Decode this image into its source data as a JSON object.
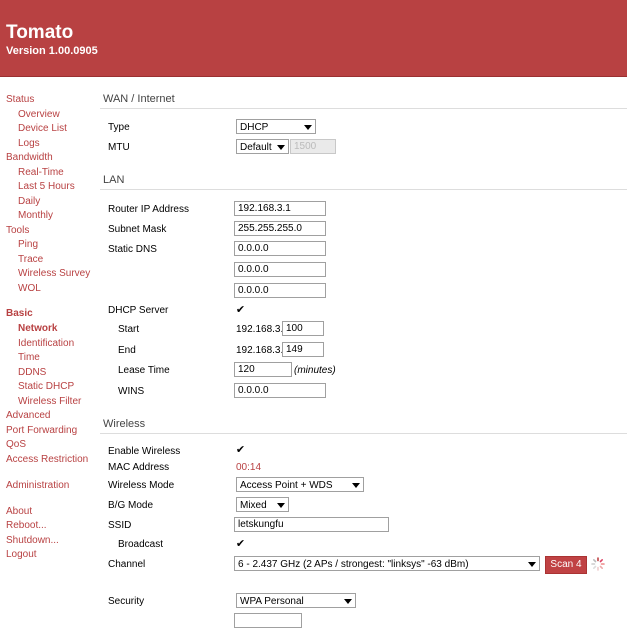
{
  "header": {
    "title": "Tomato",
    "version": "Version 1.00.0905"
  },
  "nav": {
    "status": "Status",
    "overview": "Overview",
    "device_list": "Device List",
    "logs": "Logs",
    "bandwidth": "Bandwidth",
    "real_time": "Real-Time",
    "last_5_hours": "Last 5 Hours",
    "daily": "Daily",
    "monthly": "Monthly",
    "tools": "Tools",
    "ping": "Ping",
    "trace": "Trace",
    "wireless_survey": "Wireless Survey",
    "wol": "WOL",
    "basic": "Basic",
    "network": "Network",
    "identification": "Identification",
    "time": "Time",
    "ddns": "DDNS",
    "static_dhcp": "Static DHCP",
    "wireless_filter": "Wireless Filter",
    "advanced": "Advanced",
    "port_forwarding": "Port Forwarding",
    "qos": "QoS",
    "access_restriction": "Access Restriction",
    "administration": "Administration",
    "about": "About",
    "reboot": "Reboot...",
    "shutdown": "Shutdown...",
    "logout": "Logout"
  },
  "wan": {
    "section": "WAN / Internet",
    "type_label": "Type",
    "type_value": "DHCP",
    "mtu_label": "MTU",
    "mtu_mode": "Default",
    "mtu_value": "1500"
  },
  "lan": {
    "section": "LAN",
    "router_ip_label": "Router IP Address",
    "router_ip": "192.168.3.1",
    "subnet_label": "Subnet Mask",
    "subnet": "255.255.255.0",
    "dns_label": "Static DNS",
    "dns1": "0.0.0.0",
    "dns2": "0.0.0.0",
    "dns3": "0.0.0.0",
    "dhcp_label": "DHCP Server",
    "start_label": "Start",
    "start_prefix": "192.168.3.",
    "start_value": "100",
    "end_label": "End",
    "end_prefix": "192.168.3.",
    "end_value": "149",
    "lease_label": "Lease Time",
    "lease_value": "120",
    "lease_unit": "(minutes)",
    "wins_label": "WINS",
    "wins_value": "0.0.0.0"
  },
  "wireless": {
    "section": "Wireless",
    "enable_label": "Enable Wireless",
    "mac_label": "MAC Address",
    "mac_value": "00:14",
    "mode_label": "Wireless Mode",
    "mode_value": "Access Point + WDS",
    "bg_label": "B/G Mode",
    "bg_value": "Mixed",
    "ssid_label": "SSID",
    "ssid_value": "letskungfu",
    "broadcast_label": "Broadcast",
    "channel_label": "Channel",
    "channel_value": "6 - 2.437 GHz (2 APs / strongest: \"linksys\" -63 dBm)",
    "scan_label": "Scan 4",
    "security_label": "Security",
    "security_value": "WPA Personal"
  },
  "checkmark": "✔",
  "colors": {
    "header": "#b84142",
    "link": "#b84142",
    "mac": "#b84142",
    "button": "#c04244"
  }
}
